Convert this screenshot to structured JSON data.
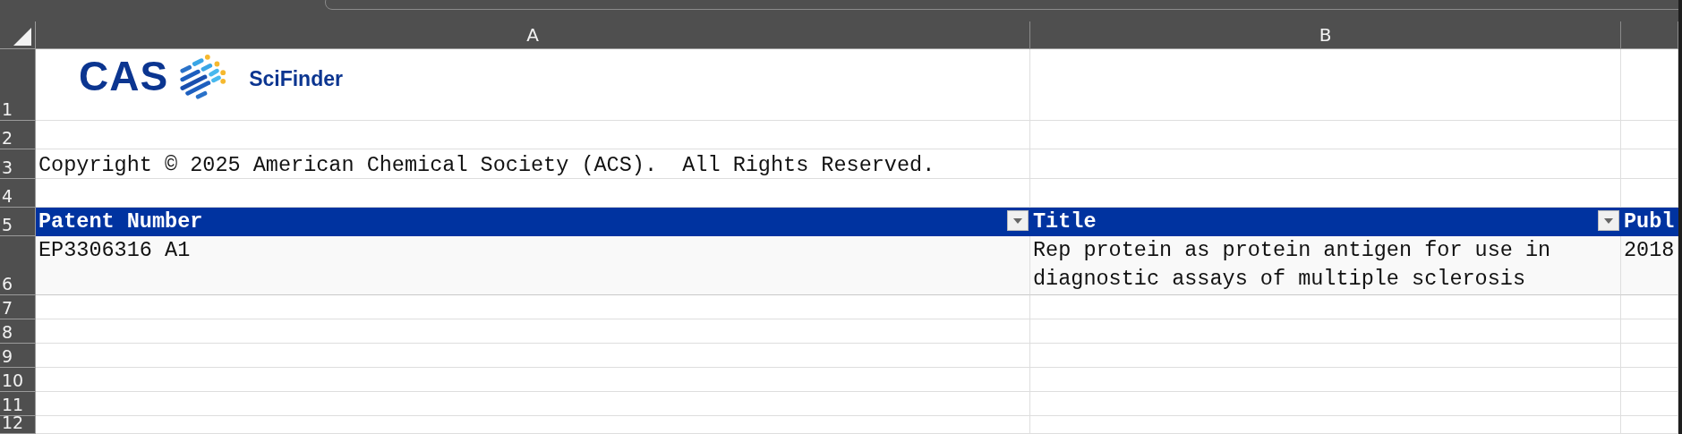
{
  "column_headers": [
    "A",
    "B"
  ],
  "row_numbers": [
    "1",
    "2",
    "3",
    "4",
    "5",
    "6",
    "7",
    "8",
    "9",
    "10",
    "11",
    "12"
  ],
  "logo": {
    "brand": "CAS",
    "product": "SciFinder"
  },
  "copyright": "Copyright © 2025 American Chemical Society (ACS).  All Rights Reserved.",
  "table": {
    "columns": [
      {
        "label": "Patent Number",
        "filter": true
      },
      {
        "label": "Title",
        "filter": true
      },
      {
        "label": "Publ",
        "filter": false
      }
    ],
    "rows": [
      [
        "EP3306316 A1",
        "Rep protein as protein antigen for use in diagnostic assays of multiple sclerosis",
        "2018"
      ]
    ]
  }
}
